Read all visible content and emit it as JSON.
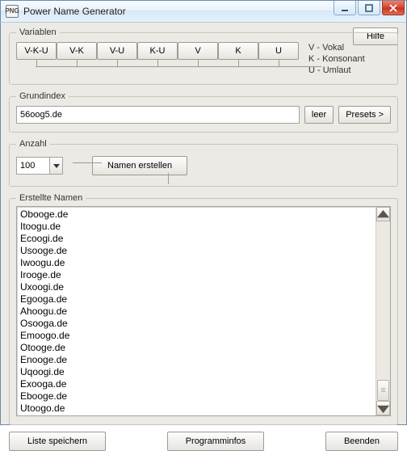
{
  "window": {
    "title": "Power Name Generator",
    "appicon_text": "PNG"
  },
  "buttons": {
    "help": "Hilfe",
    "leer": "leer",
    "presets": "Presets >",
    "create": "Namen erstellen",
    "save_list": "Liste speichern",
    "info": "Programminfos",
    "exit": "Beenden"
  },
  "labels": {
    "variablen": "Variablen",
    "grundindex": "Grundindex",
    "anzahl": "Anzahl",
    "erstellte": "Erstellte Namen"
  },
  "legend": {
    "v": "V - Vokal",
    "k": "K - Konsonant",
    "u": "U - Umlaut"
  },
  "variables": [
    "V-K-U",
    "V-K",
    "V-U",
    "K-U",
    "V",
    "K",
    "U"
  ],
  "grundindex": {
    "value": "56oog5.de"
  },
  "anzahl": {
    "value": "100"
  },
  "names": [
    "Obooge.de",
    "Itoogu.de",
    "Ecoogi.de",
    "Usooge.de",
    "Iwoogu.de",
    "Irooge.de",
    "Uxoogi.de",
    "Egooga.de",
    "Ahoogu.de",
    "Osooga.de",
    "Emoogo.de",
    "Otooge.de",
    "Enooge.de",
    "Uqoogi.de",
    "Exooga.de",
    "Ebooge.de",
    "Utoogo.de"
  ]
}
